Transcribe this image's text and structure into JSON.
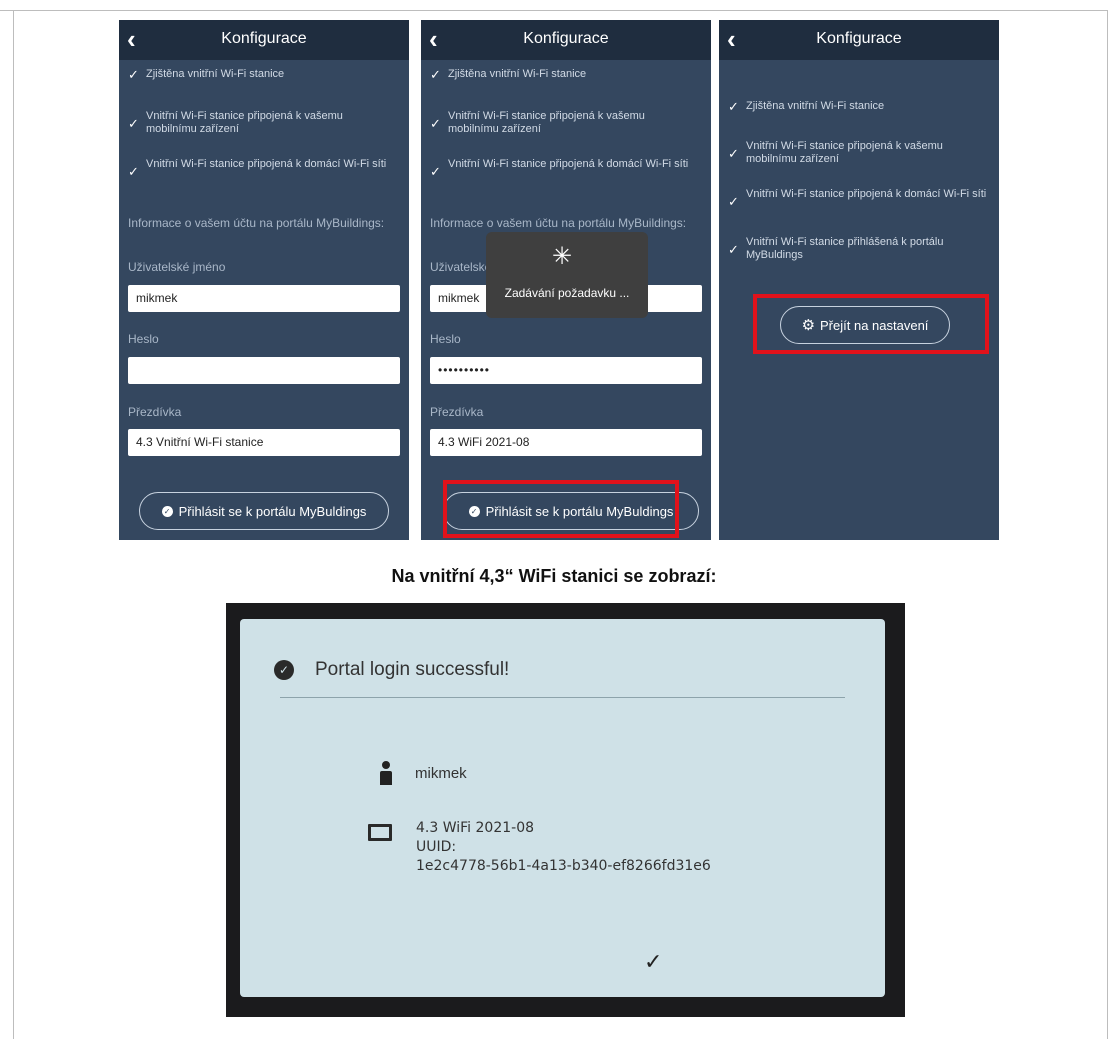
{
  "screens": [
    {
      "title": "Konfigurace",
      "steps": [
        "Zjištěna vnitřní Wi-Fi stanice",
        "Vnitřní Wi-Fi stanice připojená k vašemu mobilnímu zařízení",
        "Vnitřní Wi-Fi stanice připojená k domácí Wi-Fi síti"
      ],
      "account_info": "Informace o vašem účtu na portálu MyBuildings:",
      "username_label": "Uživatelské jméno",
      "username_value": "mikmek",
      "password_label": "Heslo",
      "password_value": "",
      "nickname_label": "Přezdívka",
      "nickname_value": "4.3 Vnitřní Wi-Fi stanice",
      "login_button": "Přihlásit se k portálu MyBuldings"
    },
    {
      "title": "Konfigurace",
      "steps": [
        "Zjištěna vnitřní Wi-Fi stanice",
        "Vnitřní Wi-Fi stanice připojená k vašemu mobilnímu zařízení",
        "Vnitřní Wi-Fi stanice připojená k domácí Wi-Fi síti"
      ],
      "account_info": "Informace o vašem účtu na portálu MyBuildings:",
      "username_label": "Uživatelské jméno",
      "username_value": "mikmek",
      "password_label": "Heslo",
      "password_value": "••••••••••",
      "nickname_label": "Přezdívka",
      "nickname_value": "4.3 WiFi 2021-08",
      "login_button": "Přihlásit se k portálu MyBuldings",
      "toast_message": "Zadávání požadavku ..."
    },
    {
      "title": "Konfigurace",
      "steps": [
        "Zjištěna vnitřní Wi-Fi stanice",
        "Vnitřní Wi-Fi stanice připojená k vašemu mobilnímu zařízení",
        "Vnitřní Wi-Fi stanice připojená k domácí Wi-Fi síti",
        "Vnitřní Wi-Fi stanice přihlášená k portálu MyBuldings"
      ],
      "settings_button": "Přejít na nastavení"
    }
  ],
  "heading": "Na vnitřní 4,3“ WiFi stanici se zobrazí:",
  "device": {
    "title": "Portal login successful!",
    "user": "mikmek",
    "device_name": "4.3 WiFi 2021-08",
    "uuid_label": "UUID:",
    "uuid": "1e2c4778-56b1-4a13-b340-ef8266fd31e6"
  },
  "icons": {
    "back": "chevron-left-icon",
    "check": "check-icon",
    "settings": "gear-icon",
    "spinner": "spinner-icon",
    "user": "person-icon",
    "device": "monitor-icon"
  },
  "colors": {
    "app_background": "#34475f",
    "app_bar": "#1f2d3f",
    "highlight": "#e1121b",
    "device_screen": "#cfe1e7"
  }
}
